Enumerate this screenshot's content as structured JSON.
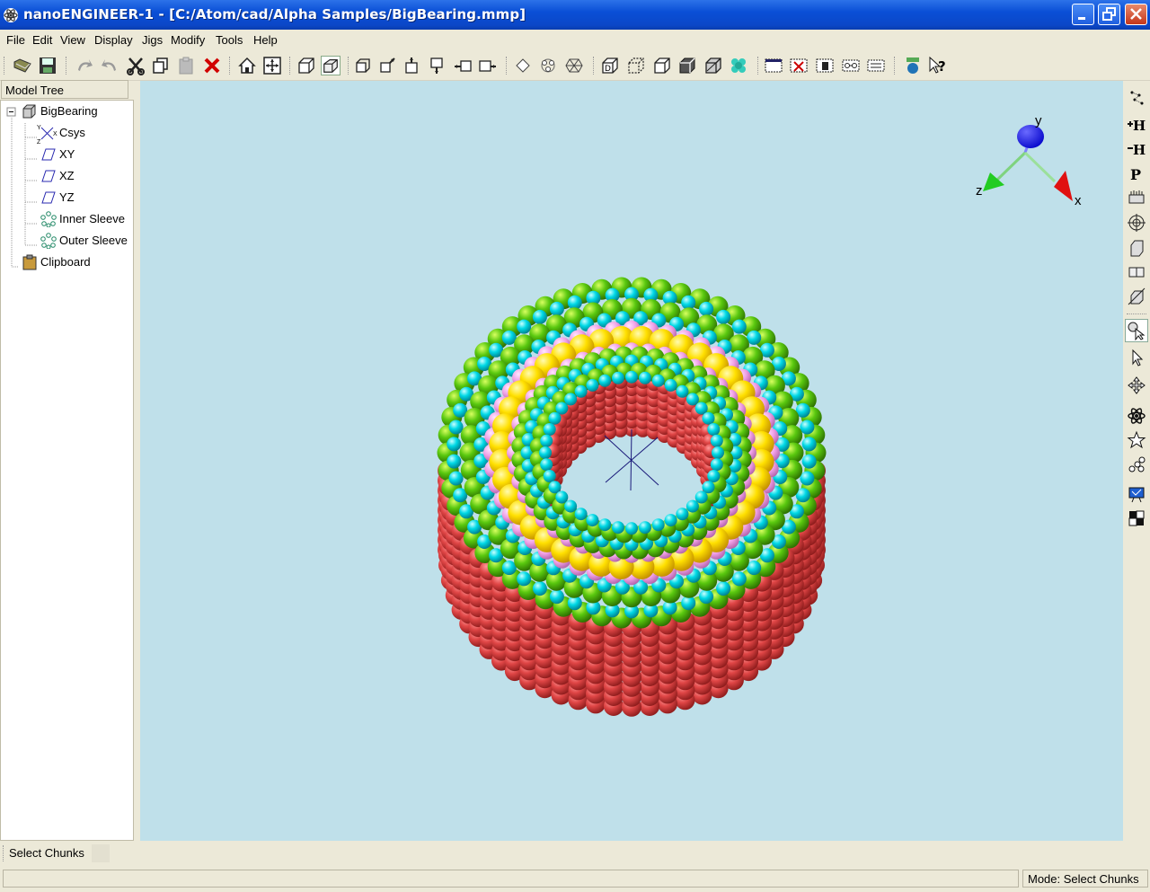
{
  "window": {
    "title": "nanoENGINEER-1 - [C:/Atom/cad/Alpha Samples/BigBearing.mmp]"
  },
  "menu": [
    "File",
    "Edit",
    "View",
    "Display",
    "Jigs",
    "Modify",
    "Tools",
    "Help"
  ],
  "model_tree": {
    "header": "Model Tree",
    "root": "BigBearing",
    "items": [
      "Csys",
      "XY",
      "XZ",
      "YZ",
      "Inner Sleeve",
      "Outer Sleeve"
    ],
    "clipboard": "Clipboard",
    "csys_axes": {
      "y": "Y",
      "z": "Z",
      "x": "X"
    }
  },
  "viewport": {
    "background": "#bfe0ea",
    "axes": {
      "y": "y",
      "z": "z",
      "x": "x"
    },
    "colors": {
      "carbon": "#59c80f",
      "hydrogen": "#00d9e6",
      "sulfur": "#ffe000",
      "silicon": "#f0a0e6",
      "oxygen": "#e04646"
    }
  },
  "mode_toolbar": {
    "label": "Select Chunks"
  },
  "status": {
    "message": "",
    "mode": "Mode: Select Chunks"
  },
  "toolbar_icons": [
    "open-icon",
    "save-icon",
    "undo-icon",
    "redo-icon",
    "cut-icon",
    "copy-icon",
    "paste-icon",
    "delete-icon",
    "home-view-icon",
    "zoom-to-fit-icon",
    "ortho-icon",
    "perspective-icon",
    "front-view-icon",
    "back-view-icon",
    "top-view-icon",
    "bottom-view-icon",
    "left-view-icon",
    "right-view-icon",
    "select-atoms-icon",
    "select-chunks-icon",
    "move-icon",
    "default-display-icon",
    "invisible-display-icon",
    "lines-display-icon",
    "ball-stick-display-icon",
    "tubes-display-icon",
    "vdw-display-icon",
    "select-all-icon",
    "select-none-icon",
    "invert-selection-icon",
    "connected-icon",
    "doubly-icon",
    "element-color-icon",
    "whats-this-icon"
  ]
}
